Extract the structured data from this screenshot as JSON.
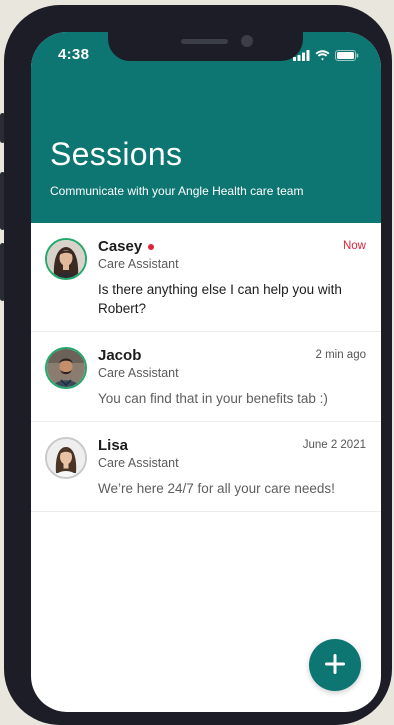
{
  "status_bar": {
    "time": "4:38"
  },
  "header": {
    "title": "Sessions",
    "subtitle": "Communicate with your Angle Health care team",
    "color": "#0d7572"
  },
  "sessions": [
    {
      "name": "Casey",
      "role": "Care Assistant",
      "time": "Now",
      "message": "Is there anything else I can help you with Robert?",
      "unread": true,
      "online": true
    },
    {
      "name": "Jacob",
      "role": "Care Assistant",
      "time": "2 min ago",
      "message": "You can find that in your benefits tab :)",
      "unread": false,
      "online": true
    },
    {
      "name": "Lisa",
      "role": "Care Assistant",
      "time": "June 2 2021",
      "message": "We’re here 24/7 for all your care needs!",
      "unread": false,
      "online": false
    }
  ],
  "fab": {
    "icon": "plus-icon"
  },
  "colors": {
    "accent": "#0d7572",
    "online": "#23a86b",
    "unread": "#e1223b"
  }
}
